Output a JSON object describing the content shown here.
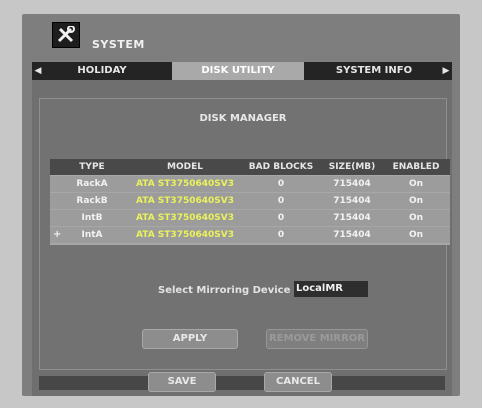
{
  "header": {
    "title": "SYSTEM",
    "icon": "tools-icon"
  },
  "tabs": [
    {
      "label": "HOLIDAY SCHEDULE",
      "active": false
    },
    {
      "label": "DISK UTILITY",
      "active": true
    },
    {
      "label": "SYSTEM INFO",
      "active": false
    }
  ],
  "disk_manager": {
    "title": "DISK MANAGER",
    "columns": [
      "TYPE",
      "MODEL",
      "BAD BLOCKS",
      "SIZE(MB)",
      "ENABLED"
    ],
    "rows": [
      {
        "marker": "",
        "type": "RackA",
        "model": "ATA ST3750640SV3",
        "bad": "0",
        "size": "715404",
        "enabled": "On"
      },
      {
        "marker": "",
        "type": "RackB",
        "model": "ATA ST3750640SV3",
        "bad": "0",
        "size": "715404",
        "enabled": "On"
      },
      {
        "marker": "",
        "type": "IntB",
        "model": "ATA ST3750640SV3",
        "bad": "0",
        "size": "715404",
        "enabled": "On"
      },
      {
        "marker": "+",
        "type": "IntA",
        "model": "ATA ST3750640SV3",
        "bad": "0",
        "size": "715404",
        "enabled": "On"
      }
    ],
    "mirror_label": "Select Mirroring Device :",
    "mirror_value": "LocalMR",
    "apply_label": "APPLY",
    "secondary_label": "REMOVE MIRROR"
  },
  "footer": {
    "save_label": "SAVE",
    "cancel_label": "CANCEL"
  },
  "colors": {
    "model_text": "#eaf25a",
    "tab_active": "#a9a9a9",
    "tabbar": "#242424"
  }
}
